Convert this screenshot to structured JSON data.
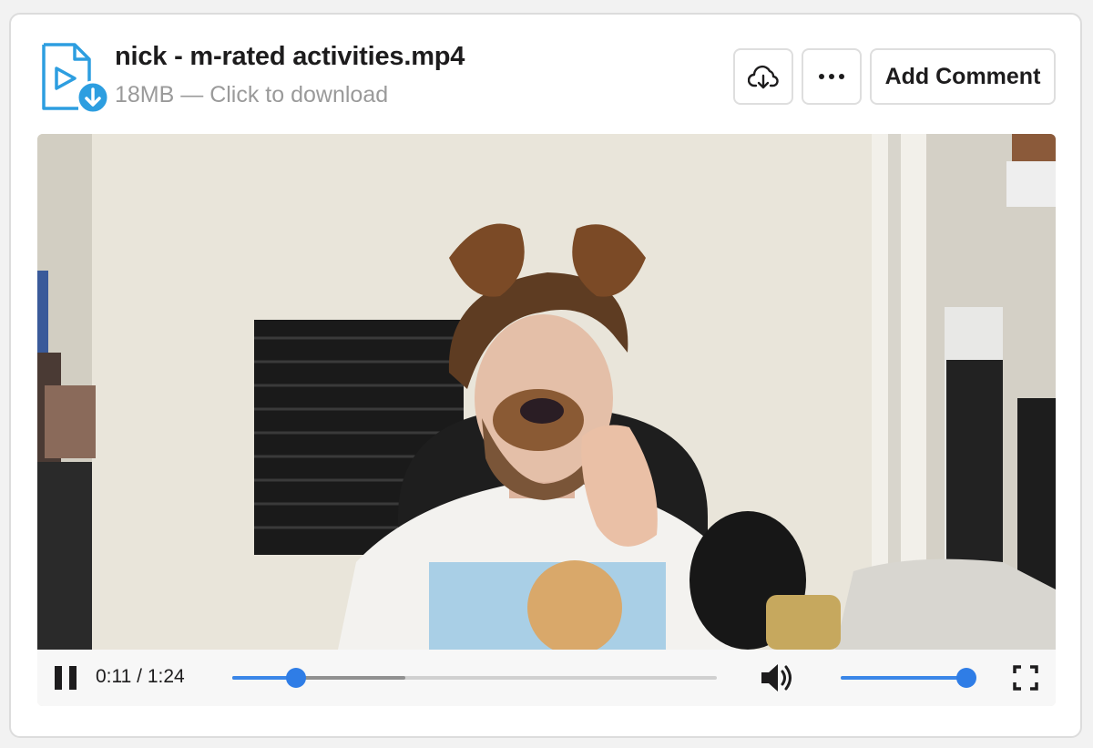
{
  "file": {
    "name": "nick - m-rated activities.mp4",
    "meta": "18MB — Click to download",
    "icon": "video-file-icon",
    "accent_color": "#2d9ee0"
  },
  "actions": {
    "download_icon": "cloud-download-icon",
    "more_icon": "ellipsis-icon",
    "comment_label": "Add Comment"
  },
  "player": {
    "state": "playing",
    "time_text": "0:11 / 1:24",
    "progress_fraction": 0.131,
    "buffered_fraction": 0.357,
    "volume_fraction": 1.0,
    "accent_color": "#3a86e8",
    "icons": [
      "pause-icon",
      "volume-icon",
      "fullscreen-icon"
    ]
  }
}
